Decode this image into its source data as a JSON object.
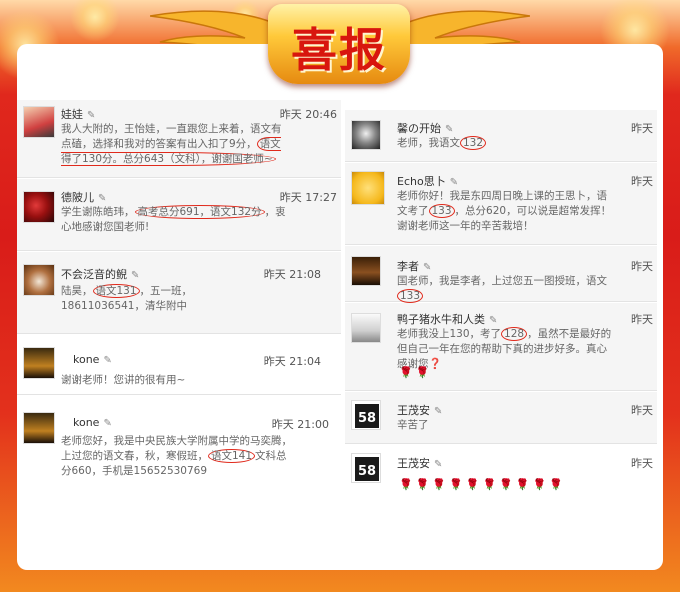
{
  "banner": {
    "title": "喜报",
    "colors": {
      "accent": "#d8160e",
      "gold": "#ffc93a",
      "highlight": "#e02a1c"
    }
  },
  "left_posts": [
    {
      "name": "娃娃",
      "time": "昨天 20:46",
      "text_before": "我人大附的，王怡娃，一直跟您上来着，语文有点磕，选择和我对的答案有出入扣了9分，",
      "highlight": "语文得了130分。总分643（文科），谢谢国老师~",
      "text_after": ""
    },
    {
      "name": "德陂儿",
      "time": "昨天 17:27",
      "text_before": "学生谢陈皓玮，",
      "highlight": "高考总分691，语文132分",
      "text_after": "，衷心地感谢您国老师!"
    },
    {
      "name": "不会泛音的鲵",
      "time": "昨天 21:08",
      "text_before": "陆昊，",
      "highlight": "语文131",
      "text_after": "，五一班，18611036541，清华附中"
    },
    {
      "name": "kone",
      "time": "昨天 21:04",
      "text_before": "谢谢老师！您讲的很有用~",
      "highlight": "",
      "text_after": ""
    },
    {
      "name": "kone",
      "time": "昨天 21:00",
      "text_before": "老师您好，我是中央民族大学附属中学的马奕腾，上过您的语文春，秋，寒假班，",
      "highlight": "语文141",
      "text_after": "文科总分660，手机是15652530769"
    }
  ],
  "right_posts": [
    {
      "name": "馨の开始",
      "time": "昨天",
      "text_before": "老师，我语文",
      "highlight": "132",
      "text_after": ""
    },
    {
      "name": "Echo思卜",
      "time": "昨天",
      "text_before": "老师你好！我是东四周日晚上课的王思卜，语文考了",
      "highlight": "133",
      "text_after": "，总分620，可以说是超常发挥！谢谢老师这一年的辛苦栽培！"
    },
    {
      "name": "李者",
      "time": "昨天",
      "text_before": "国老师，我是李者，上过您五一图授班，语文",
      "highlight": "133",
      "text_after": ""
    },
    {
      "name": "鸭子猪水牛和人类",
      "time": "昨天",
      "text_before": "老师我没上130，考了",
      "highlight": "128",
      "text_after": "，虽然不是最好的但自己一年在您的帮助下真的进步好多。真心感谢您❓",
      "roses": 2
    },
    {
      "name": "王茂安",
      "time": "昨天",
      "text_before": "辛苦了",
      "highlight": "",
      "text_after": ""
    },
    {
      "name": "王茂安",
      "time": "昨天",
      "text_before": "",
      "highlight": "",
      "text_after": "",
      "roses": 10
    }
  ],
  "icons": {
    "edit": "pencil-icon",
    "flower": "rose-icon"
  }
}
